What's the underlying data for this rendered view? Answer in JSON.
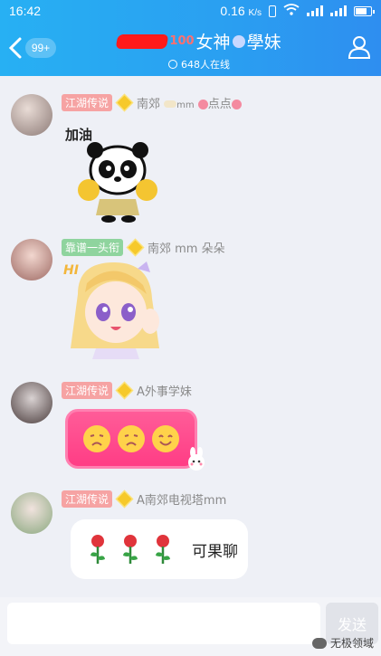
{
  "status": {
    "time": "16:42",
    "speed": "0.16",
    "speed_unit": "K/s"
  },
  "header": {
    "badge": "99+",
    "title_suffix": "女神",
    "title_end": "學妹",
    "online": "648人在线"
  },
  "messages": [
    {
      "tag": "江湖传说",
      "tag_color": "red",
      "nick_a": "南郊",
      "nick_b": "mm",
      "nick_c": "点点"
    },
    {
      "tag": "靠谱一头衔",
      "tag_color": "green",
      "nick": "南郊 mm 朵朵"
    },
    {
      "tag": "江湖传说",
      "tag_color": "red",
      "nick": "A外事学妹"
    },
    {
      "tag": "江湖传说",
      "tag_color": "red",
      "nick": "A南郊电视塔mm",
      "bubble_text": "可果聊"
    }
  ],
  "stickers": {
    "panda_text": "加油",
    "girl_text": "HI"
  },
  "input": {
    "placeholder": "",
    "send_label": "发送"
  },
  "watermark": "无极领域",
  "colors": {
    "header": "#2a9ff1",
    "tag_red": "#f6a3a3",
    "tag_green": "#8fd49e",
    "pink_bubble": "#ff4a8c"
  }
}
